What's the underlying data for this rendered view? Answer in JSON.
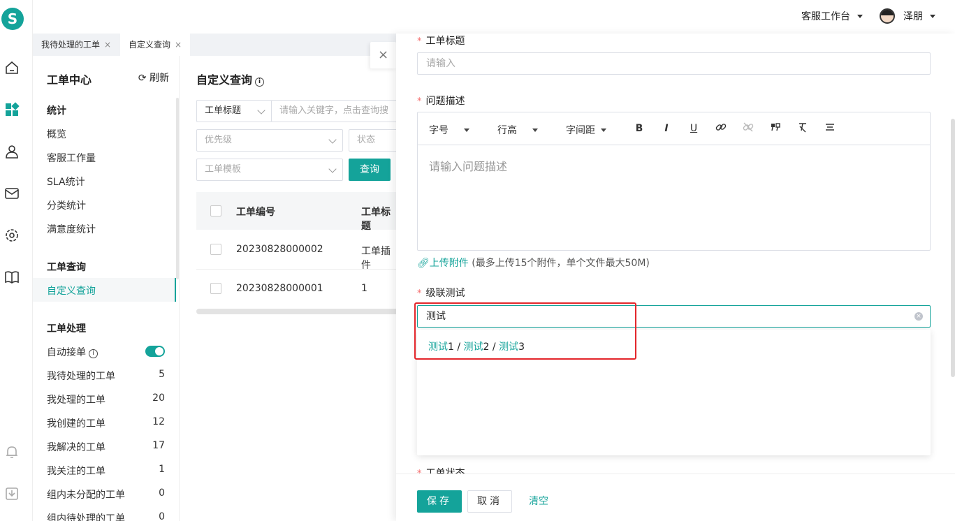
{
  "brand": {
    "logo_letter": "S",
    "accent": "#14a39a"
  },
  "rail_icons": [
    "home-icon",
    "apps-icon",
    "contacts-icon",
    "mail-icon",
    "gear-icon",
    "book-icon",
    "bell-icon",
    "download-icon"
  ],
  "topbar": {
    "workspace_label": "客服工作台",
    "user_name": "泽朋"
  },
  "tabs": [
    {
      "label": "我待处理的工单",
      "close": "×"
    },
    {
      "label": "自定义查询",
      "close": "×"
    }
  ],
  "sidebar": {
    "title": "工单中心",
    "refresh": "刷新",
    "sections": {
      "stats": {
        "title": "统计",
        "items": [
          "概览",
          "客服工作量",
          "SLA统计",
          "分类统计",
          "满意度统计"
        ]
      },
      "query": {
        "title": "工单查询",
        "items": [
          "自定义查询"
        ]
      },
      "handle": {
        "title": "工单处理",
        "auto_accept": "自动接单",
        "items": [
          {
            "label": "我待处理的工单",
            "count": "5"
          },
          {
            "label": "我处理的工单",
            "count": "20"
          },
          {
            "label": "我创建的工单",
            "count": "12"
          },
          {
            "label": "我解决的工单",
            "count": "17"
          },
          {
            "label": "我关注的工单",
            "count": "1"
          },
          {
            "label": "组内未分配的工单",
            "count": "0"
          },
          {
            "label": "组内待处理的工单",
            "count": "0"
          }
        ]
      }
    }
  },
  "query_panel": {
    "title": "自定义查询",
    "field_select": "工单标题",
    "keyword_placeholder": "请输入关键字，点击查询搜",
    "priority_placeholder": "优先级",
    "status_placeholder": "状态",
    "template_placeholder": "工单模板",
    "query_button": "查询",
    "columns": [
      "工单编号",
      "工单标题"
    ],
    "rows": [
      {
        "id": "20230828000002",
        "title": "工单插件"
      },
      {
        "id": "20230828000001",
        "title": "1"
      }
    ]
  },
  "drawer": {
    "close": "×",
    "title_label": "工单标题",
    "title_placeholder": "请输入",
    "desc_label": "问题描述",
    "toolbar": {
      "font_size": "字号",
      "line_height": "行高",
      "letter_spacing": "字间距",
      "bold": "B",
      "italic": "I",
      "underline": "U"
    },
    "desc_placeholder": "请输入问题描述",
    "upload_link": "上传附件",
    "upload_note": "(最多上传15个附件，单个文件最大50M)",
    "cascade_label": "级联测试",
    "cascade_value": "测试",
    "cascade_option": {
      "part1_hl": "测试",
      "part1": "1",
      "sep1": " / ",
      "part2_hl": "测试",
      "part2": "2",
      "sep2": " / ",
      "part3_hl": "测试",
      "part3": "3"
    },
    "status_label": "工单状态",
    "save": "保存",
    "cancel": "取消",
    "clear": "清空"
  }
}
